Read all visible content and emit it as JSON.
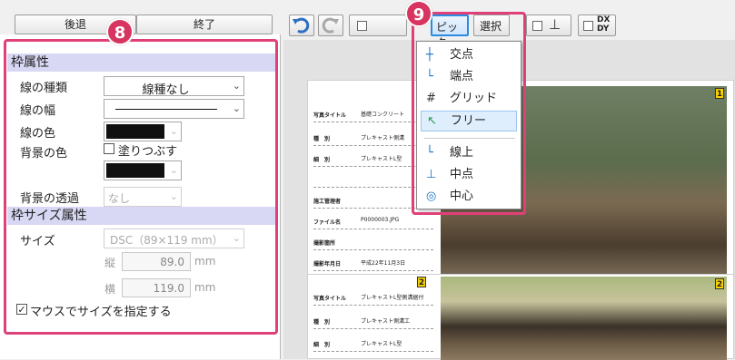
{
  "top": {
    "back_button": "後退",
    "end_button": "終了"
  },
  "badges": {
    "panel": "8",
    "menu": "9"
  },
  "frame_attr": {
    "title": "枠属性",
    "line_type": {
      "label": "線の種類",
      "value": "線種なし"
    },
    "line_width": {
      "label": "線の幅"
    },
    "line_color": {
      "label": "線の色",
      "color": "#111111"
    },
    "bg_color": {
      "label": "背景の色",
      "fill_label": "塗りつぶす",
      "fill_checked": false,
      "color": "#111111"
    },
    "bg_transparency": {
      "label": "背景の透過",
      "value": "なし"
    }
  },
  "size_attr": {
    "title": "枠サイズ属性",
    "size": {
      "label": "サイズ",
      "value": "DSC（89×119 mm）"
    },
    "height": {
      "label": "縦",
      "value": "89.0",
      "unit": "mm"
    },
    "width": {
      "label": "横",
      "value": "119.0",
      "unit": "mm"
    },
    "mouse_size": {
      "label": "マウスでサイズを指定する",
      "checked": true
    }
  },
  "toolbar": {
    "pick_label": "ピック",
    "select_label": "選択",
    "dxdy_top": "DX",
    "dxdy_bottom": "DY"
  },
  "pick_menu": {
    "items": [
      {
        "label": "交点",
        "icon": "intersection-icon"
      },
      {
        "label": "端点",
        "icon": "endpoint-icon"
      },
      {
        "label": "グリッド",
        "icon": "grid-icon"
      },
      {
        "label": "フリー",
        "icon": "free-icon"
      },
      {
        "label": "線上",
        "icon": "on-line-icon"
      },
      {
        "label": "中点",
        "icon": "midpoint-icon"
      },
      {
        "label": "中心",
        "icon": "center-icon"
      }
    ]
  },
  "document": {
    "block1": {
      "rows": [
        {
          "k": "写真タイトル",
          "v": "基礎コンクリート"
        },
        {
          "k": "種　別",
          "v": "プレキャスト側溝"
        },
        {
          "k": "細　別",
          "v": "プレキャストL型"
        },
        {
          "k": "",
          "v": ""
        },
        {
          "k": "施工管理者",
          "v": ""
        },
        {
          "k": "ファイル名",
          "v": "P0000003.JPG"
        },
        {
          "k": "撮影箇所",
          "v": ""
        },
        {
          "k": "撮影年月日",
          "v": "平成22年11月3日"
        }
      ],
      "tag_small": "1",
      "tag_photo": "1"
    },
    "block2": {
      "rows": [
        {
          "k": "写真タイトル",
          "v": "プレキャストL型側溝据付"
        },
        {
          "k": "種　別",
          "v": "プレキャスト側溝工"
        },
        {
          "k": "細　別",
          "v": "プレキャストL型"
        }
      ],
      "tag_small": "2",
      "tag_photo": "2"
    }
  }
}
